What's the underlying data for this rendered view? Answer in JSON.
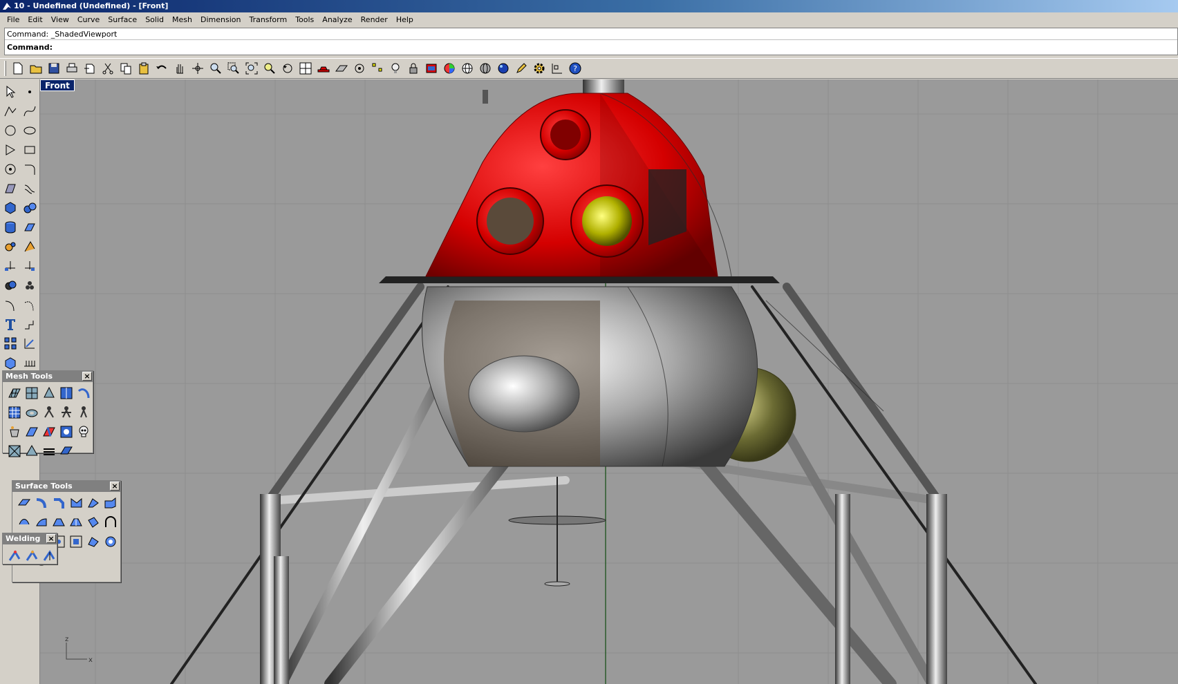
{
  "window": {
    "title": "10 - Undefined (Undefined) - [Front]"
  },
  "menu": [
    "File",
    "Edit",
    "View",
    "Curve",
    "Surface",
    "Solid",
    "Mesh",
    "Dimension",
    "Transform",
    "Tools",
    "Analyze",
    "Render",
    "Help"
  ],
  "command": {
    "history": "Command: _ShadedViewport",
    "prompt": "Command:",
    "value": ""
  },
  "toolbar": {
    "buttons": [
      "new-file-icon",
      "open-folder-icon",
      "save-icon",
      "print-icon",
      "import-icon",
      "cut-icon",
      "copy-icon",
      "paste-icon",
      "undo-icon",
      "pan-hand-icon",
      "rotate-view-icon",
      "zoom-icon",
      "zoom-window-icon",
      "zoom-extents-icon",
      "zoom-selected-icon",
      "undo-view-icon",
      "four-viewports-icon",
      "car-icon",
      "grid-icon",
      "snap-icon",
      "points-icon",
      "light-bulb-icon",
      "lock-icon",
      "layer-icon",
      "color-wheel-icon",
      "wireframe-sphere-icon",
      "shaded-sphere-icon",
      "rendered-sphere-icon",
      "pencil-icon",
      "gear-icon",
      "measure-icon",
      "help-icon"
    ]
  },
  "left_tools": [
    "select-arrow-icon",
    "point-icon",
    "polyline-icon",
    "curve-icon",
    "circle-icon",
    "ellipse-icon",
    "polygon-icon",
    "rectangle-icon",
    "arc-icon",
    "fillet-curve-icon",
    "surface-corner-icon",
    "loft-icon",
    "box-icon",
    "sphere-icon",
    "cylinder-icon",
    "extrude-icon",
    "explode-icon",
    "boolean-icon",
    "trim-icon",
    "split-icon",
    "boolean-union-icon",
    "boolean-split-icon",
    "offset-curve-icon",
    "blend-curve-icon",
    "text-icon",
    "dimension-icon",
    "array-icon",
    "scale-icon",
    "solid-edit-icon",
    "history-icon"
  ],
  "viewport": {
    "label": "Front"
  },
  "palettes": {
    "mesh_tools": {
      "title": "Mesh Tools",
      "close": "×"
    },
    "surface_tools": {
      "title": "Surface Tools",
      "close": "×"
    },
    "welding": {
      "title": "Welding",
      "close": "×"
    }
  },
  "axis": {
    "z": "z",
    "x": "x"
  },
  "colors": {
    "accent_red": "#d40000",
    "viewport_bg": "#9a9a9a",
    "title_blue": "#0a246a",
    "olive_sphere": "#6b6b33"
  }
}
